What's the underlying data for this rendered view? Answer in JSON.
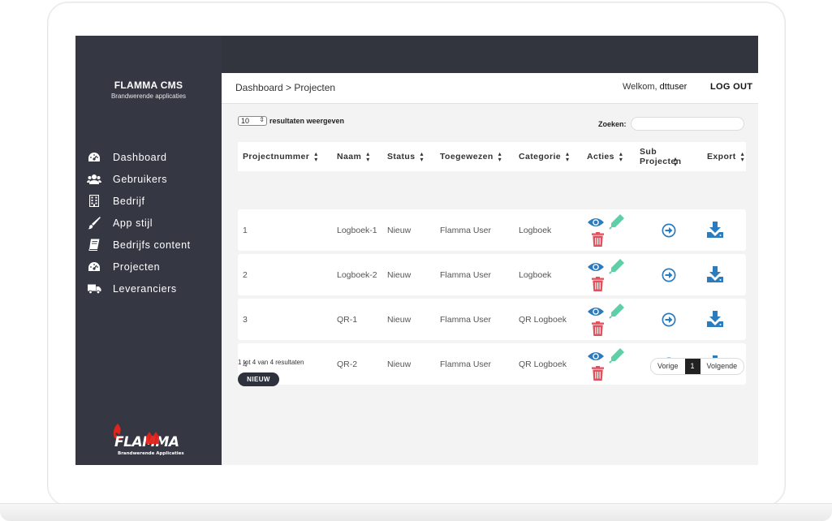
{
  "sidebar": {
    "title": "FLAMMA CMS",
    "subtitle": "Brandwerende applicaties",
    "items": [
      {
        "label": "Dashboard",
        "icon": "tachometer-icon"
      },
      {
        "label": "Gebruikers",
        "icon": "users-icon"
      },
      {
        "label": "Bedrijf",
        "icon": "building-icon"
      },
      {
        "label": "App stijl",
        "icon": "paintbrush-icon"
      },
      {
        "label": "Bedrijfs content",
        "icon": "book-icon"
      },
      {
        "label": "Projecten",
        "icon": "tachometer-icon"
      },
      {
        "label": "Leveranciers",
        "icon": "truck-icon"
      }
    ],
    "logo_text": "FLAMMA",
    "logo_sub": "Brandwerende Applicaties"
  },
  "header": {
    "breadcrumb": "Dashboard > Projecten",
    "welcome_prefix": "Welkom,",
    "username": "dttuser",
    "logout": "LOG OUT"
  },
  "controls": {
    "page_length": "10",
    "page_length_label": "resultaten weergeven",
    "search_label": "Zoeken:",
    "search_value": ""
  },
  "table": {
    "columns": [
      "Projectnummer",
      "Naam",
      "Status",
      "Toegewezen",
      "Categorie",
      "Acties",
      "Sub Projecten",
      "Export"
    ],
    "rows": [
      {
        "nummer": "1",
        "naam": "Logboek-1",
        "status": "Nieuw",
        "toegewezen": "Flamma User",
        "categorie": "Logboek"
      },
      {
        "nummer": "2",
        "naam": "Logboek-2",
        "status": "Nieuw",
        "toegewezen": "Flamma User",
        "categorie": "Logboek"
      },
      {
        "nummer": "3",
        "naam": "QR-1",
        "status": "Nieuw",
        "toegewezen": "Flamma User",
        "categorie": "QR Logboek"
      },
      {
        "nummer": "4",
        "naam": "QR-2",
        "status": "Nieuw",
        "toegewezen": "Flamma User",
        "categorie": "QR Logboek"
      }
    ]
  },
  "footer": {
    "info": "1 tot 4 van 4 resultaten",
    "new_button": "NIEUW",
    "prev": "Vorige",
    "current_page": "1",
    "next": "Volgende"
  },
  "colors": {
    "sidebar_bg": "#353743",
    "view_icon": "#2b7bbf",
    "edit_icon": "#5fcfa8",
    "delete_icon": "#e0515e",
    "action_blue": "#2b7bbf"
  }
}
